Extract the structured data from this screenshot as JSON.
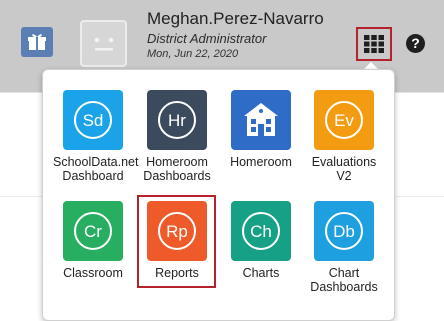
{
  "header": {
    "user_name": "Meghan.Perez-Navarro",
    "user_role": "District Administrator",
    "date": "Mon, Jun 22, 2020",
    "help_symbol": "?",
    "colors": {
      "header_bg": "#c9c9c9",
      "gift_bg": "#5b7eb4",
      "highlight": "#b7212c"
    }
  },
  "apps_menu": {
    "apps": [
      {
        "abbr": "Sd",
        "label_line1": "SchoolData.net",
        "label_line2": "Dashboard",
        "color": "#1aa3e8",
        "icon": "sd-circle-icon"
      },
      {
        "abbr": "Hr",
        "label_line1": "Homeroom",
        "label_line2": "Dashboards",
        "color": "#3b4a5c",
        "icon": "hr-circle-icon"
      },
      {
        "abbr": "",
        "label_line1": "Homeroom",
        "label_line2": "",
        "color": "#2f6cc8",
        "icon": "school-building-icon"
      },
      {
        "abbr": "Ev",
        "label_line1": "Evaluations",
        "label_line2": "V2",
        "color": "#f39c12",
        "icon": "ev-circle-icon"
      },
      {
        "abbr": "Cr",
        "label_line1": "Classroom",
        "label_line2": "",
        "color": "#27ae60",
        "icon": "cr-circle-icon"
      },
      {
        "abbr": "Rp",
        "label_line1": "Reports",
        "label_line2": "",
        "color": "#ee5a2a",
        "icon": "rp-circle-icon",
        "highlighted": true
      },
      {
        "abbr": "Ch",
        "label_line1": "Charts",
        "label_line2": "",
        "color": "#16a085",
        "icon": "ch-circle-icon"
      },
      {
        "abbr": "Db",
        "label_line1": "Chart",
        "label_line2": "Dashboards",
        "color": "#1e9fe0",
        "icon": "db-circle-icon"
      }
    ]
  }
}
